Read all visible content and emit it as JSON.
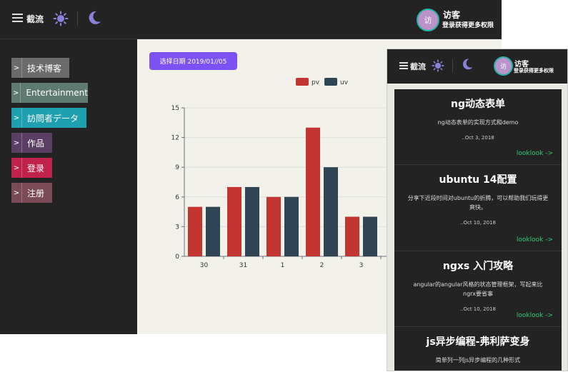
{
  "header": {
    "brand": "截流",
    "user_avatar_char": "访",
    "user_name": "访客",
    "user_subtitle": "登录获得更多权限"
  },
  "sidebar": {
    "items": [
      {
        "label": "技术博客",
        "color": "#6b6b6b",
        "arrow": ">"
      },
      {
        "label": "Entertainment",
        "color": "#5e7a71",
        "arrow": ">"
      },
      {
        "label": "訪問者データ",
        "color": "#1fa0b0",
        "arrow": ">"
      },
      {
        "label": "作品",
        "color": "#5a3e63",
        "arrow": ">"
      },
      {
        "label": "登录",
        "color": "#c0224a",
        "arrow": ">"
      },
      {
        "label": "注册",
        "color": "#7a4a57",
        "arrow": ">"
      }
    ]
  },
  "main": {
    "date_button": "选择日期 2019/01//05"
  },
  "chart_data": {
    "type": "bar",
    "categories": [
      "30",
      "31",
      "1",
      "2",
      "3"
    ],
    "series": [
      {
        "name": "pv",
        "values": [
          5,
          7,
          6,
          13,
          4
        ],
        "color": "#c23531"
      },
      {
        "name": "uv",
        "values": [
          5,
          7,
          6,
          9,
          4
        ],
        "color": "#2f4554"
      }
    ],
    "ylim": [
      0,
      15
    ],
    "yticks": [
      "0",
      "3",
      "6",
      "9",
      "12",
      "15"
    ],
    "legend": "top",
    "grid": true
  },
  "mobile": {
    "cards": [
      {
        "title": "ng动态表单",
        "desc": "ng动态表单的实现方式和demo",
        "date": "..Oct 3, 2018",
        "link": "looklook ->"
      },
      {
        "title": "ubuntu 14配置",
        "desc": "分享下近段时间对ubuntu的折腾，可以帮助我们玩得更爽快。",
        "date": "..Oct 10, 2018",
        "link": "looklook ->"
      },
      {
        "title": "ngxs 入门攻略",
        "desc": "angular的angular风格的状态管理框架，写起来比ngrx要省事",
        "date": "..Oct 10, 2018",
        "link": "looklook ->"
      },
      {
        "title": "js异步编程-弗利萨变身",
        "desc": "简单列一列js异步编程的几种形式",
        "date": "",
        "link": ""
      }
    ]
  }
}
